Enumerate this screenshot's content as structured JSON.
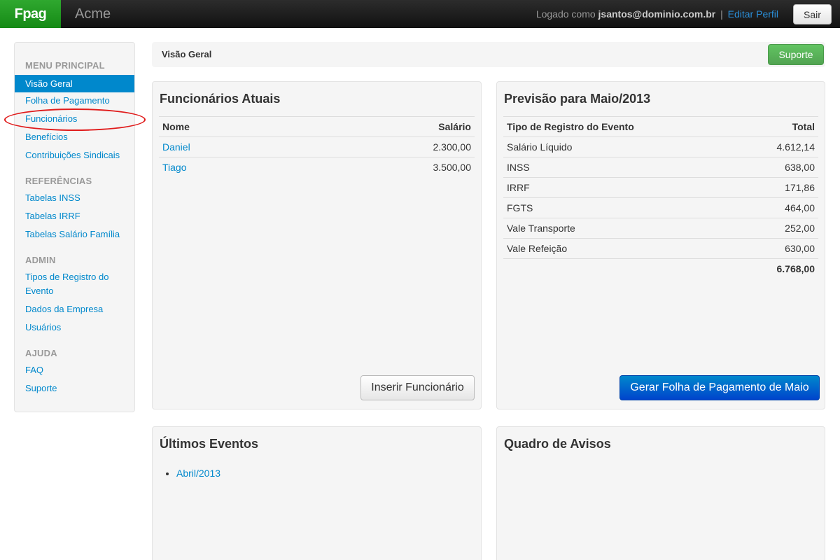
{
  "navbar": {
    "brand": "Fpag",
    "company": "Acme",
    "logged_prefix": "Logado como",
    "user": "jsantos@dominio.com.br",
    "separator": "|",
    "edit_profile": "Editar Perfil",
    "logout": "Sair"
  },
  "sidebar": {
    "sections": [
      {
        "header": "MENU PRINCIPAL"
      },
      {
        "header": "REFERÊNCIAS"
      },
      {
        "header": "ADMIN"
      },
      {
        "header": "AJUDA"
      }
    ],
    "items": [
      "Visão Geral",
      "Folha de Pagamento",
      "Funcionários",
      "Benefícios",
      "Contribuições Sindicais",
      "Tabelas INSS",
      "Tabelas IRRF",
      "Tabelas Salário Família",
      "Tipos de Registro do",
      "Evento",
      "Dados da Empresa",
      "Usuários",
      "FAQ",
      "Suporte"
    ],
    "annotation_color": "#e01b1b"
  },
  "breadcrumb": {
    "title": "Visão Geral",
    "support_button": "Suporte"
  },
  "employees": {
    "title": "Funcionários Atuais",
    "columns": [
      "Nome",
      "Salário"
    ],
    "rows": [
      {
        "name": "Daniel",
        "salary": "2.300,00"
      },
      {
        "name": "Tiago",
        "salary": "3.500,00"
      }
    ],
    "button": "Inserir Funcionário"
  },
  "forecast": {
    "title": "Previsão para Maio/2013",
    "columns": [
      "Tipo de Registro do Evento",
      "Total"
    ],
    "rows": [
      {
        "type": "Salário Líquido",
        "total": "4.612,14"
      },
      {
        "type": "INSS",
        "total": "638,00"
      },
      {
        "type": "IRRF",
        "total": "171,86"
      },
      {
        "type": "FGTS",
        "total": "464,00"
      },
      {
        "type": "Vale Transporte",
        "total": "252,00"
      },
      {
        "type": "Vale Refeição",
        "total": "630,00"
      }
    ],
    "grand_total": "6.768,00",
    "button": "Gerar Folha de Pagamento de Maio"
  },
  "events": {
    "title": "Últimos Eventos",
    "items": [
      "Abril/2013"
    ]
  },
  "notices": {
    "title": "Quadro de Avisos"
  },
  "colors": {
    "brand": "#1f9a1f",
    "link": "#0088cc",
    "success": "#5bb75b",
    "primary": "#0066cc"
  }
}
